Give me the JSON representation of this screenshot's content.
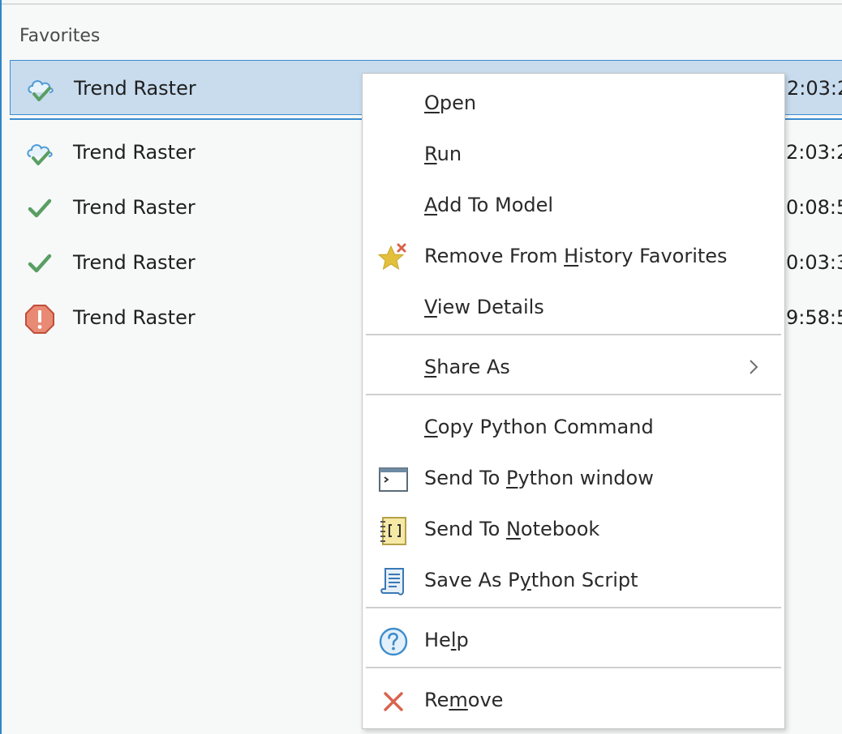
{
  "panel": {
    "section_label": "Favorites",
    "rows": [
      {
        "name": "Trend Raster",
        "time": "2:03:2",
        "status": "cloud-check-icon"
      },
      {
        "name": "Trend Raster",
        "time": "2:03:2",
        "status": "cloud-check-icon"
      },
      {
        "name": "Trend Raster",
        "time": "0:08:5",
        "status": "check-icon"
      },
      {
        "name": "Trend Raster",
        "time": "0:03:3",
        "status": "check-icon"
      },
      {
        "name": "Trend Raster",
        "time": "9:58:5",
        "status": "error-octagon-icon"
      }
    ]
  },
  "menu": {
    "items": [
      {
        "pre": "",
        "key": "O",
        "post": "pen"
      },
      {
        "pre": "",
        "key": "R",
        "post": "un"
      },
      {
        "pre": "",
        "key": "A",
        "post": "dd To Model"
      },
      {
        "pre": "Remove From ",
        "key": "H",
        "post": "istory Favorites",
        "icon": "star-remove-icon"
      },
      {
        "pre": "",
        "key": "V",
        "post": "iew Details"
      },
      {
        "pre": "",
        "key": "S",
        "post": "hare As",
        "submenu": "chevron-right-icon"
      },
      {
        "pre": "",
        "key": "C",
        "post": "opy Python Command"
      },
      {
        "pre": "Send To ",
        "key": "P",
        "post": "ython window",
        "icon": "python-window-icon"
      },
      {
        "pre": "Send To ",
        "key": "N",
        "post": "otebook",
        "icon": "notebook-icon"
      },
      {
        "pre": "Save As P",
        "key": "y",
        "post": "thon Script",
        "icon": "python-script-icon"
      },
      {
        "pre": "He",
        "key": "l",
        "post": "p",
        "icon": "help-icon"
      },
      {
        "pre": "Re",
        "key": "m",
        "post": "ove",
        "icon": "remove-x-icon"
      }
    ]
  },
  "colors": {
    "selection_bg": "#c8dcee",
    "selection_border": "#3a8bd0",
    "success_green": "#5a9e63",
    "error_red": "#d86a55",
    "remove_red": "#d9634e",
    "star_gold": "#e2c03c"
  }
}
